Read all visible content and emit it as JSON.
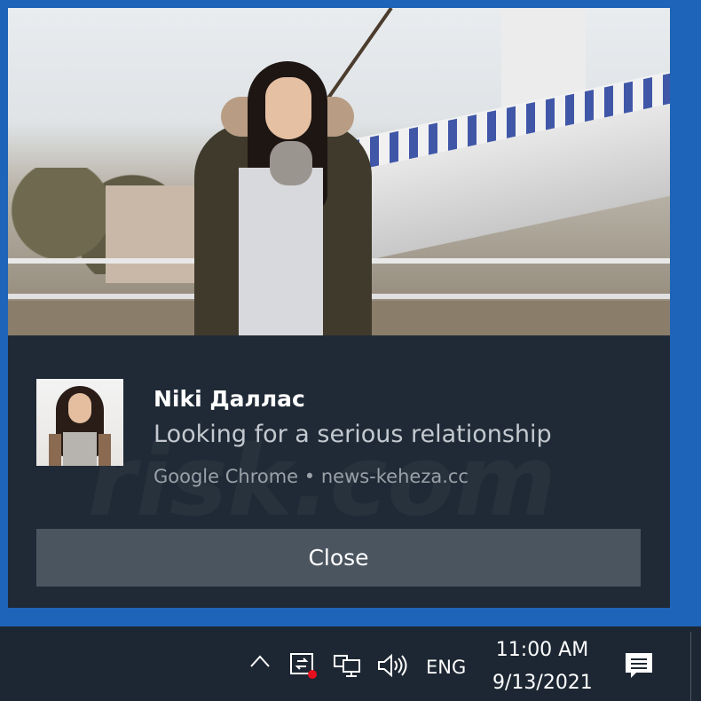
{
  "notification": {
    "sender_name": "Niki Даллас",
    "message": "Looking for a serious relationship",
    "source": "Google Chrome • news-keheza.cc",
    "close_label": "Close",
    "watermark": "risk.com"
  },
  "taskbar": {
    "language": "ENG",
    "time": "11:00 AM",
    "date": "9/13/2021",
    "icons": [
      "chevron-up-icon",
      "network-icon",
      "monitor-icon",
      "volume-icon",
      "notification-center-icon"
    ]
  },
  "colors": {
    "accent": "#1e64b8",
    "toast_bg": "#1f2a36",
    "button_bg": "#4b5560",
    "taskbar_bg": "#1d2733",
    "alert_dot": "#e8101e"
  }
}
